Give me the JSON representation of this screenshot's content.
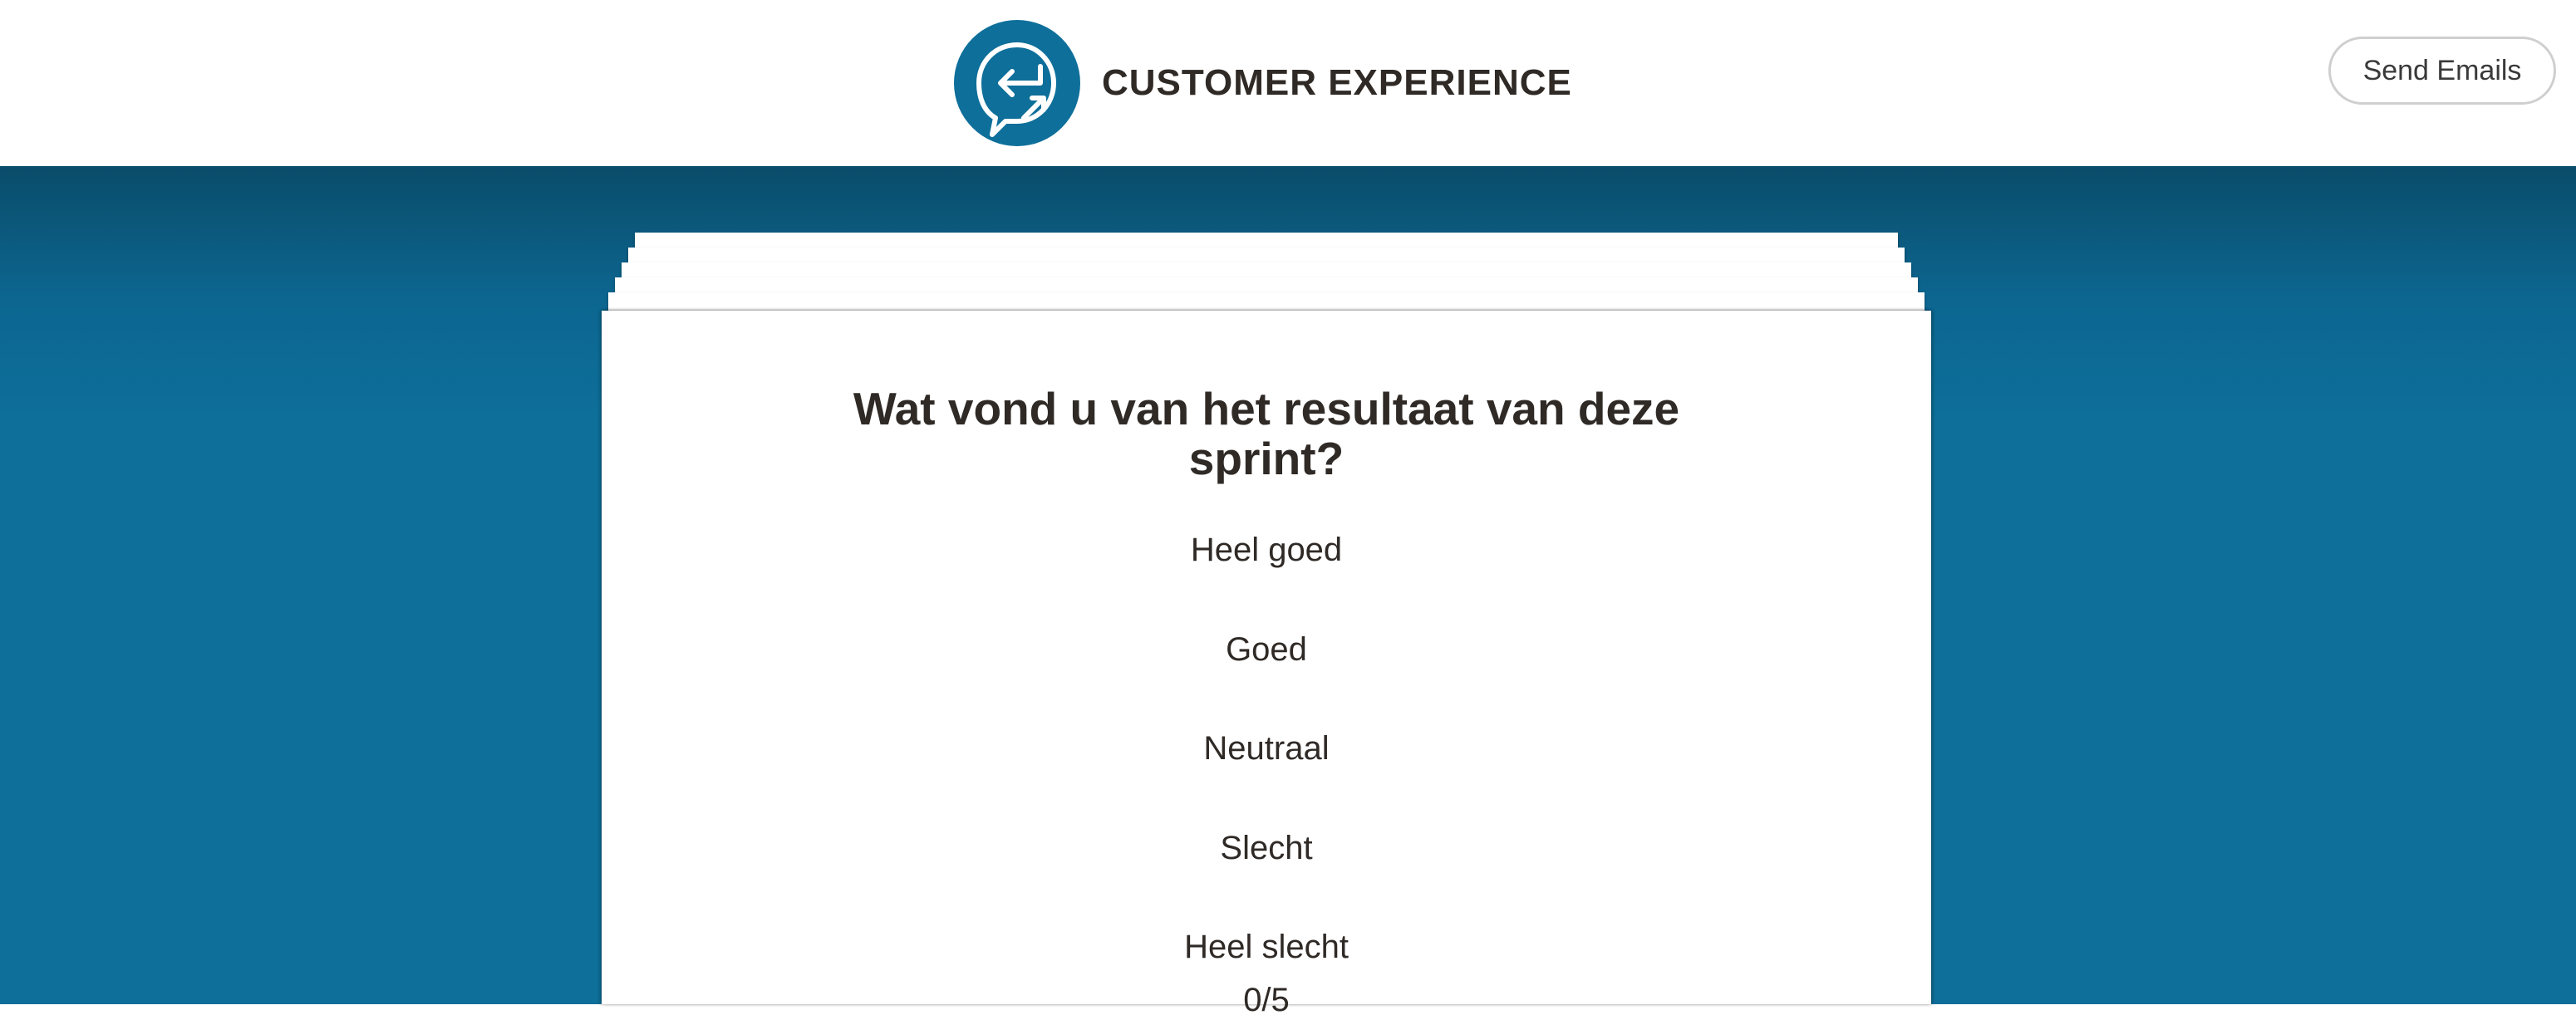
{
  "header": {
    "logo_icon": "arrow-return-chat-icon",
    "title": "CUSTOMER EXPERIENCE",
    "send_button_label": "Send Emails"
  },
  "colors": {
    "brand_blue": "#0e6f9a",
    "brand_blue_dark": "#0a4c6a",
    "text_dark": "#2f2a26",
    "card_background": "#ffffff"
  },
  "survey": {
    "question": "Wat vond u van het resultaat van deze sprint?",
    "options": [
      {
        "label": "Heel goed"
      },
      {
        "label": "Goed"
      },
      {
        "label": "Neutraal"
      },
      {
        "label": "Slecht"
      },
      {
        "label": "Heel slecht"
      }
    ],
    "progress_text": "0/5",
    "answered": 0,
    "total": 5
  }
}
